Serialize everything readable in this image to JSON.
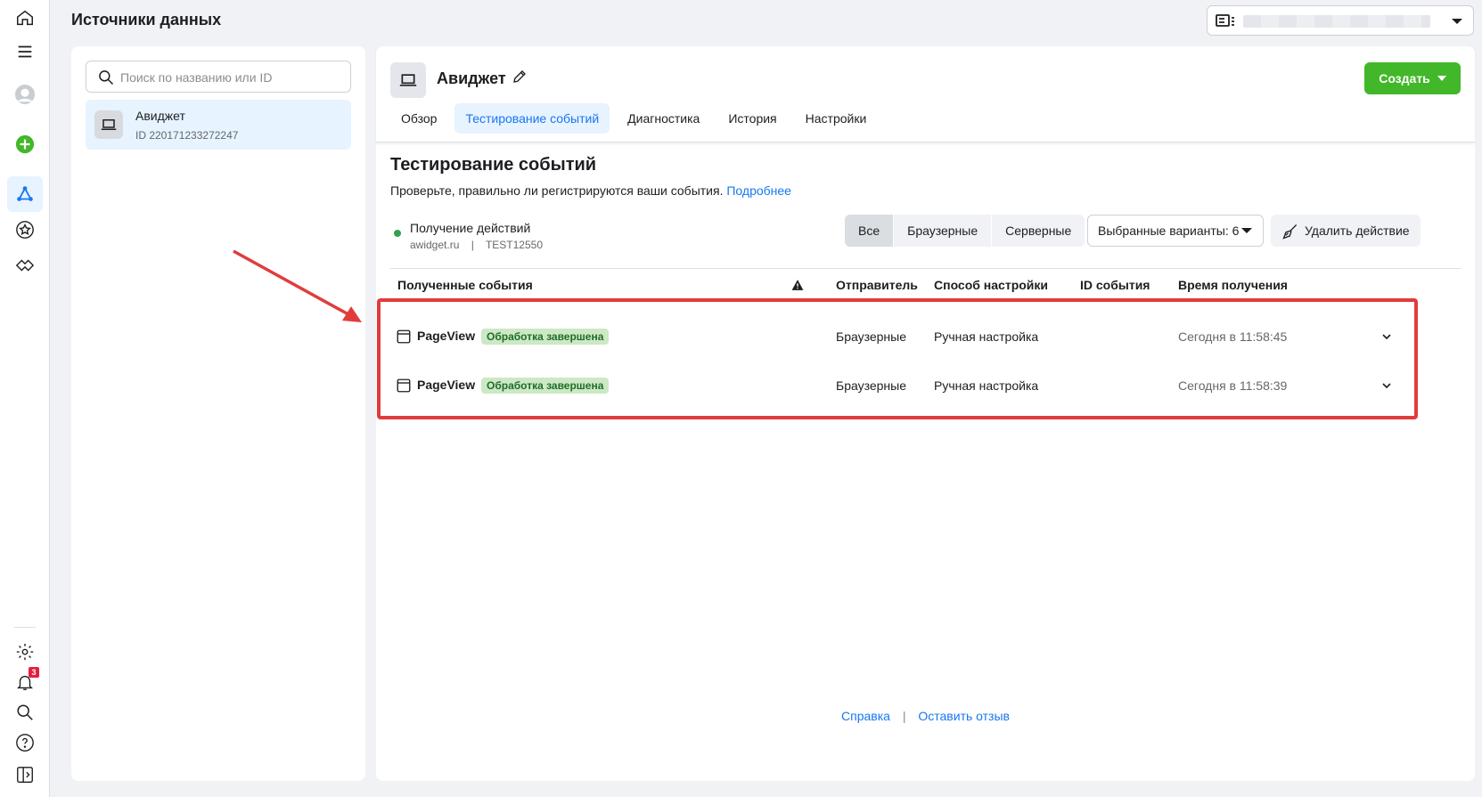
{
  "page_title": "Источники данных",
  "search": {
    "placeholder": "Поиск по названию или ID"
  },
  "source": {
    "name": "Авиджет",
    "id_text": "ID 220171233272247"
  },
  "header": {
    "name": "Авиджет",
    "create_label": "Создать",
    "tabs": [
      {
        "label": "Обзор"
      },
      {
        "label": "Тестирование событий"
      },
      {
        "label": "Диагностика"
      },
      {
        "label": "История"
      },
      {
        "label": "Настройки"
      }
    ]
  },
  "section": {
    "title": "Тестирование событий",
    "desc": "Проверьте, правильно ли регистрируются ваши события.",
    "link": "Подробнее"
  },
  "status": {
    "label": "Получение действий",
    "domain": "awidget.ru",
    "separator": "|",
    "code": "TEST12550"
  },
  "filters": {
    "all": "Все",
    "browser": "Браузерные",
    "server": "Серверные"
  },
  "variants_label": "Выбранные варианты: 6",
  "clear_label": "Удалить действие",
  "table": {
    "headers": {
      "events": "Полученные события",
      "sender": "Отправитель",
      "method": "Способ настройки",
      "event_id": "ID события",
      "time": "Время получения"
    },
    "rows": [
      {
        "name": "PageView",
        "badge": "Обработка завершена",
        "sender": "Браузерные",
        "method": "Ручная настройка",
        "time": "Сегодня в 11:58:45"
      },
      {
        "name": "PageView",
        "badge": "Обработка завершена",
        "sender": "Браузерные",
        "method": "Ручная настройка",
        "time": "Сегодня в 11:58:39"
      }
    ]
  },
  "footer": {
    "help": "Справка",
    "separator": "|",
    "feedback": "Оставить отзыв"
  },
  "notifications_count": "3",
  "colors": {
    "accent": "#1877f2",
    "create": "#42b72a",
    "success_badge": "#cde8c4",
    "highlight": "#e03c3c"
  }
}
